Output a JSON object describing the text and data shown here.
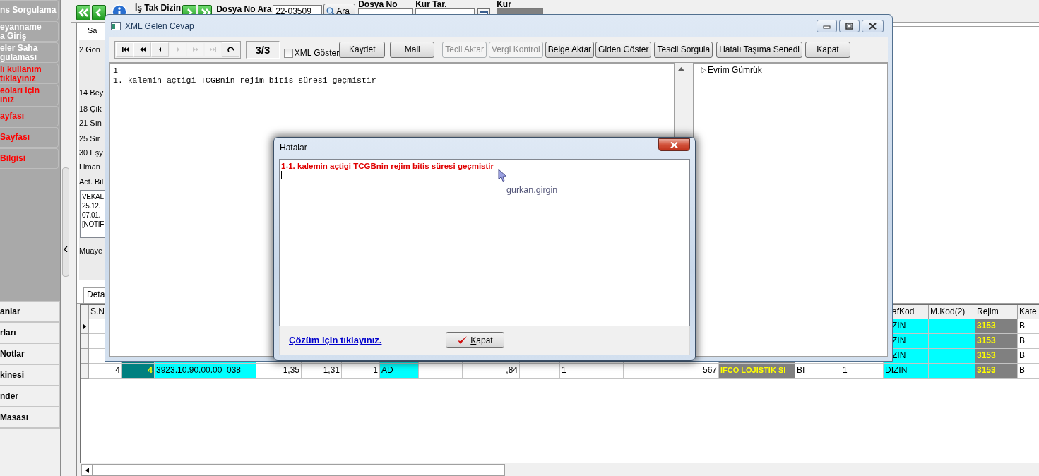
{
  "sidebar": {
    "items": [
      {
        "label": "ns Sorgulama",
        "color": "#ffffff"
      },
      {
        "label": "eyanname\na Giriş",
        "color": "#ffffff"
      },
      {
        "label": "eler Saha\ngulaması",
        "color": "#ffffff"
      },
      {
        "label": "lı kullanım\ntıklayınız",
        "color": "#ff0000"
      },
      {
        "label": "eoları için\nınız",
        "color": "#ff0000"
      },
      {
        "label": "ayfası",
        "color": "#ff0000"
      },
      {
        "label": "Sayfası",
        "color": "#ff0000"
      },
      {
        "label": "Bilgisi",
        "color": "#ff0000"
      }
    ],
    "bottom_items": [
      "anlar",
      "rları",
      "Notlar",
      "kinesi",
      "nder",
      "Masası"
    ]
  },
  "topbar": {
    "title": "İş Tak Dizin",
    "search_label": "Dosya No Ara",
    "search_value": "22-03509",
    "search_button": "Ara",
    "file_no_label": "Dosya No",
    "rate_date_label": "Kur Tar.",
    "rate_label": "Kur"
  },
  "background": {
    "header": "Sa",
    "labels": [
      "2 Gön",
      "14 Bey",
      "18 Çık",
      "21 Sın",
      "25 Sır",
      "30 Eşy",
      "Liman",
      "Act. Bil"
    ],
    "notes_lines": [
      "VEKAL",
      "25.12.",
      "07.01.",
      "[NOTIF"
    ],
    "inspection_label": "Muaye",
    "tabs": [
      {
        "label": "Deta",
        "selected": true
      }
    ]
  },
  "grid": {
    "columns": [
      "S.N",
      null,
      null,
      null,
      null,
      null,
      null,
      null,
      null,
      null,
      null,
      null,
      null,
      null,
      null,
      null,
      null,
      "afKod",
      "M.Kod(2)",
      "Rejim",
      "Kate"
    ],
    "rows": [
      {
        "selected": true,
        "cells": [
          null,
          null,
          null,
          null,
          null,
          null,
          null,
          null,
          null,
          null,
          null,
          null,
          null,
          null,
          null,
          null,
          null,
          "ZIN",
          null,
          "3153",
          "B"
        ]
      },
      {
        "selected": false,
        "cells": [
          null,
          null,
          null,
          null,
          null,
          null,
          null,
          null,
          null,
          null,
          null,
          null,
          null,
          null,
          null,
          null,
          null,
          "ZIN",
          null,
          "3153",
          "B"
        ]
      },
      {
        "selected": false,
        "cells": [
          null,
          null,
          null,
          null,
          null,
          null,
          null,
          null,
          null,
          null,
          null,
          null,
          null,
          null,
          null,
          null,
          null,
          "ZIN",
          null,
          "3153",
          "B"
        ]
      },
      {
        "selected": false,
        "cells": [
          "4",
          "4",
          "3923.10.90.00.00",
          "038",
          "1,35",
          "1,31",
          "1",
          "AD",
          null,
          ",84",
          null,
          "1",
          null,
          "567",
          "IFCO LOJISTIK SI",
          "BI",
          "1",
          "DIZIN",
          null,
          "3153",
          "B"
        ]
      }
    ]
  },
  "xml_window": {
    "title": "XML Gelen Cevap",
    "nav_buttons": [
      {
        "kind": "first",
        "disabled": false
      },
      {
        "kind": "rewind",
        "disabled": false
      },
      {
        "kind": "prev",
        "disabled": false
      },
      {
        "kind": "next",
        "disabled": true
      },
      {
        "kind": "forward",
        "disabled": true
      },
      {
        "kind": "last",
        "disabled": true
      },
      {
        "kind": "refresh",
        "disabled": false
      }
    ],
    "counter": "3/3",
    "xml_toggle": {
      "label": "XML Göster",
      "checked": false
    },
    "buttons": [
      {
        "label": "Kaydet",
        "disabled": false
      },
      {
        "label": "Mail",
        "disabled": false
      },
      {
        "label": "Tecil Aktar",
        "disabled": true
      },
      {
        "label": "Vergi Kontrol",
        "disabled": true
      },
      {
        "label": "Belge Aktar",
        "disabled": false
      },
      {
        "label": "Giden Göster",
        "disabled": false
      },
      {
        "label": "Tescil Sorgula",
        "disabled": false
      },
      {
        "label": "Hatalı Taşıma Senedi",
        "disabled": false
      },
      {
        "label": "Kapat",
        "disabled": false
      }
    ],
    "response_lines": [
      "1",
      "1. kalemin açtigi TCGBnin rejim bitis süresi geçmistir"
    ],
    "tree": [
      {
        "label": "Evrim Gümrük",
        "expanded": false
      }
    ]
  },
  "errors_dialog": {
    "title": "Hatalar",
    "messages": [
      "1-1. kalemin açtigi TCGBnin rejim bitis süresi geçmistir"
    ],
    "user": "gurkan.girgin",
    "help_link": "Çözüm için tıklayınız.",
    "close_button": "Kapat"
  }
}
